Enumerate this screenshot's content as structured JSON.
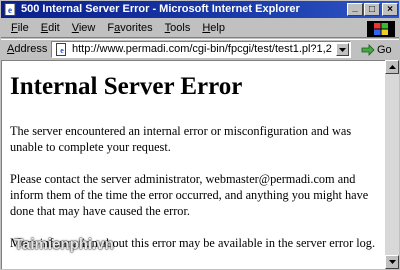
{
  "window": {
    "title": "500 Internal Server Error - Microsoft Internet Explorer",
    "controls": [
      "_",
      "□",
      "×"
    ]
  },
  "menu": {
    "items": [
      {
        "underline": "F",
        "rest": "ile"
      },
      {
        "underline": "E",
        "rest": "dit"
      },
      {
        "underline": "V",
        "rest": "iew"
      },
      {
        "pre": "F",
        "underline": "a",
        "rest": "vorites"
      },
      {
        "underline": "T",
        "rest": "ools"
      },
      {
        "underline": "H",
        "rest": "elp"
      }
    ]
  },
  "address": {
    "label_underline": "A",
    "label_rest": "ddress",
    "url": "http://www.permadi.com/cgi-bin/fpcgi/test/test1.pl?1,2",
    "go_label": "Go"
  },
  "page": {
    "heading": "Internal Server Error",
    "paragraph1": "The server encountered an internal error or misconfiguration and was unable to complete your request.",
    "paragraph2": "Please contact the server administrator, webmaster@permadi.com and inform them of the time the error occurred, and anything you might have done that may have caused the error.",
    "paragraph3": "More information about this error may be available in the server error log."
  },
  "watermark": "Taimienphi.vn",
  "icons": {
    "app": "ie-page-icon",
    "logo": "windows-logo-icon",
    "page": "page-icon",
    "dropdown": "chevron-down-icon",
    "go": "go-arrow-icon",
    "scroll_up": "scroll-up-arrow-icon",
    "scroll_down": "scroll-down-arrow-icon"
  },
  "colors": {
    "titlebar": "#0a1f8c",
    "chrome": "#c0c0c0",
    "content_bg": "#ffffff"
  }
}
